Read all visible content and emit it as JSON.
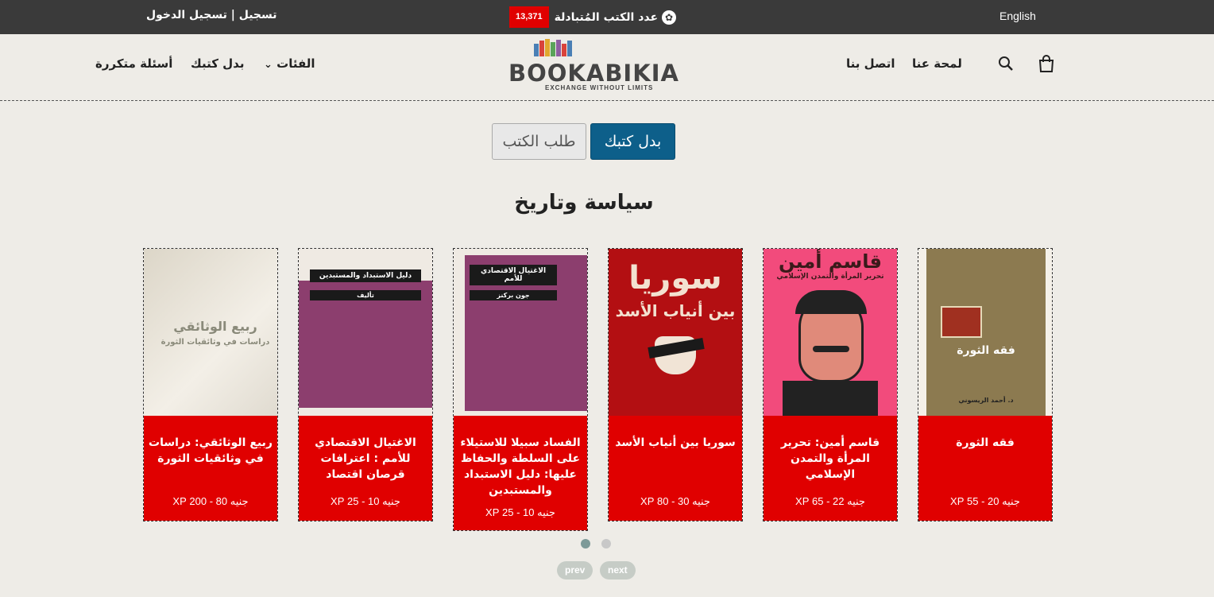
{
  "topbar": {
    "language": "English",
    "exchanged_label": "عدد الكتب المُتبادلة",
    "exchanged_count": "13,371",
    "login": "تسجيل | تسجيل الدخول"
  },
  "nav": {
    "about": "لمحة عنا",
    "contact": "اتصل بنا",
    "categories": "الفئات",
    "swap": "بدل كتبك",
    "faq": "أسئلة متكررة"
  },
  "logo": {
    "name": "BOOKABIKIA",
    "tagline": "EXCHANGE WITHOUT LIMITS"
  },
  "toggle": {
    "swap": "بدل كتبك",
    "request": "طلب الكتب",
    "active": "swap"
  },
  "section_title": "سياسة وتاريخ",
  "books": [
    {
      "title": "فقه الثورة",
      "price": "جنيه 20 - 55 XP",
      "cover_text": "فقه الثورة",
      "cover_author": "د. أحمد الريسوني"
    },
    {
      "title": "قاسم أمين: تحرير المرأة والتمدن الإسلامي",
      "price": "جنيه 22 - 65 XP",
      "cover_text": "قاسم أمين",
      "cover_author": "تحرير المرأة والتمدن الإسلامي"
    },
    {
      "title": "سوريا بين أنياب الأسد",
      "price": "جنيه 30 - 80 XP",
      "cover_text": "سوريا",
      "cover_author": "بين أنياب الأسد"
    },
    {
      "title": "الفساد سبيلا للاستيلاء على السلطة والحفاظ عليها: دليل الاستبداد والمستبدين",
      "price": "جنيه 10 - 25 XP",
      "cover_text": "الاغتيال الاقتصادي للأمم",
      "cover_author": "جون بركنز"
    },
    {
      "title": "الاغتيال الاقتصادي للأمم : اعترافات قرصان اقتصاد",
      "price": "جنيه 10 - 25 XP",
      "cover_text": "دليل الاستبداد والمستبدين",
      "cover_author": "تأليف"
    },
    {
      "title": "ربيع الوثائقي: دراسات في وثائقيات الثورة",
      "price": "جنيه 80 - 200 XP",
      "cover_text": "ربيع الوثائقي",
      "cover_author": "دراسات في وثائقيات الثورة"
    }
  ],
  "pager": {
    "prev": "prev",
    "next": "next"
  },
  "colors": {
    "accent_red": "#e00000",
    "button_blue": "#0d5f8a",
    "topbar": "#3a3a3a"
  }
}
